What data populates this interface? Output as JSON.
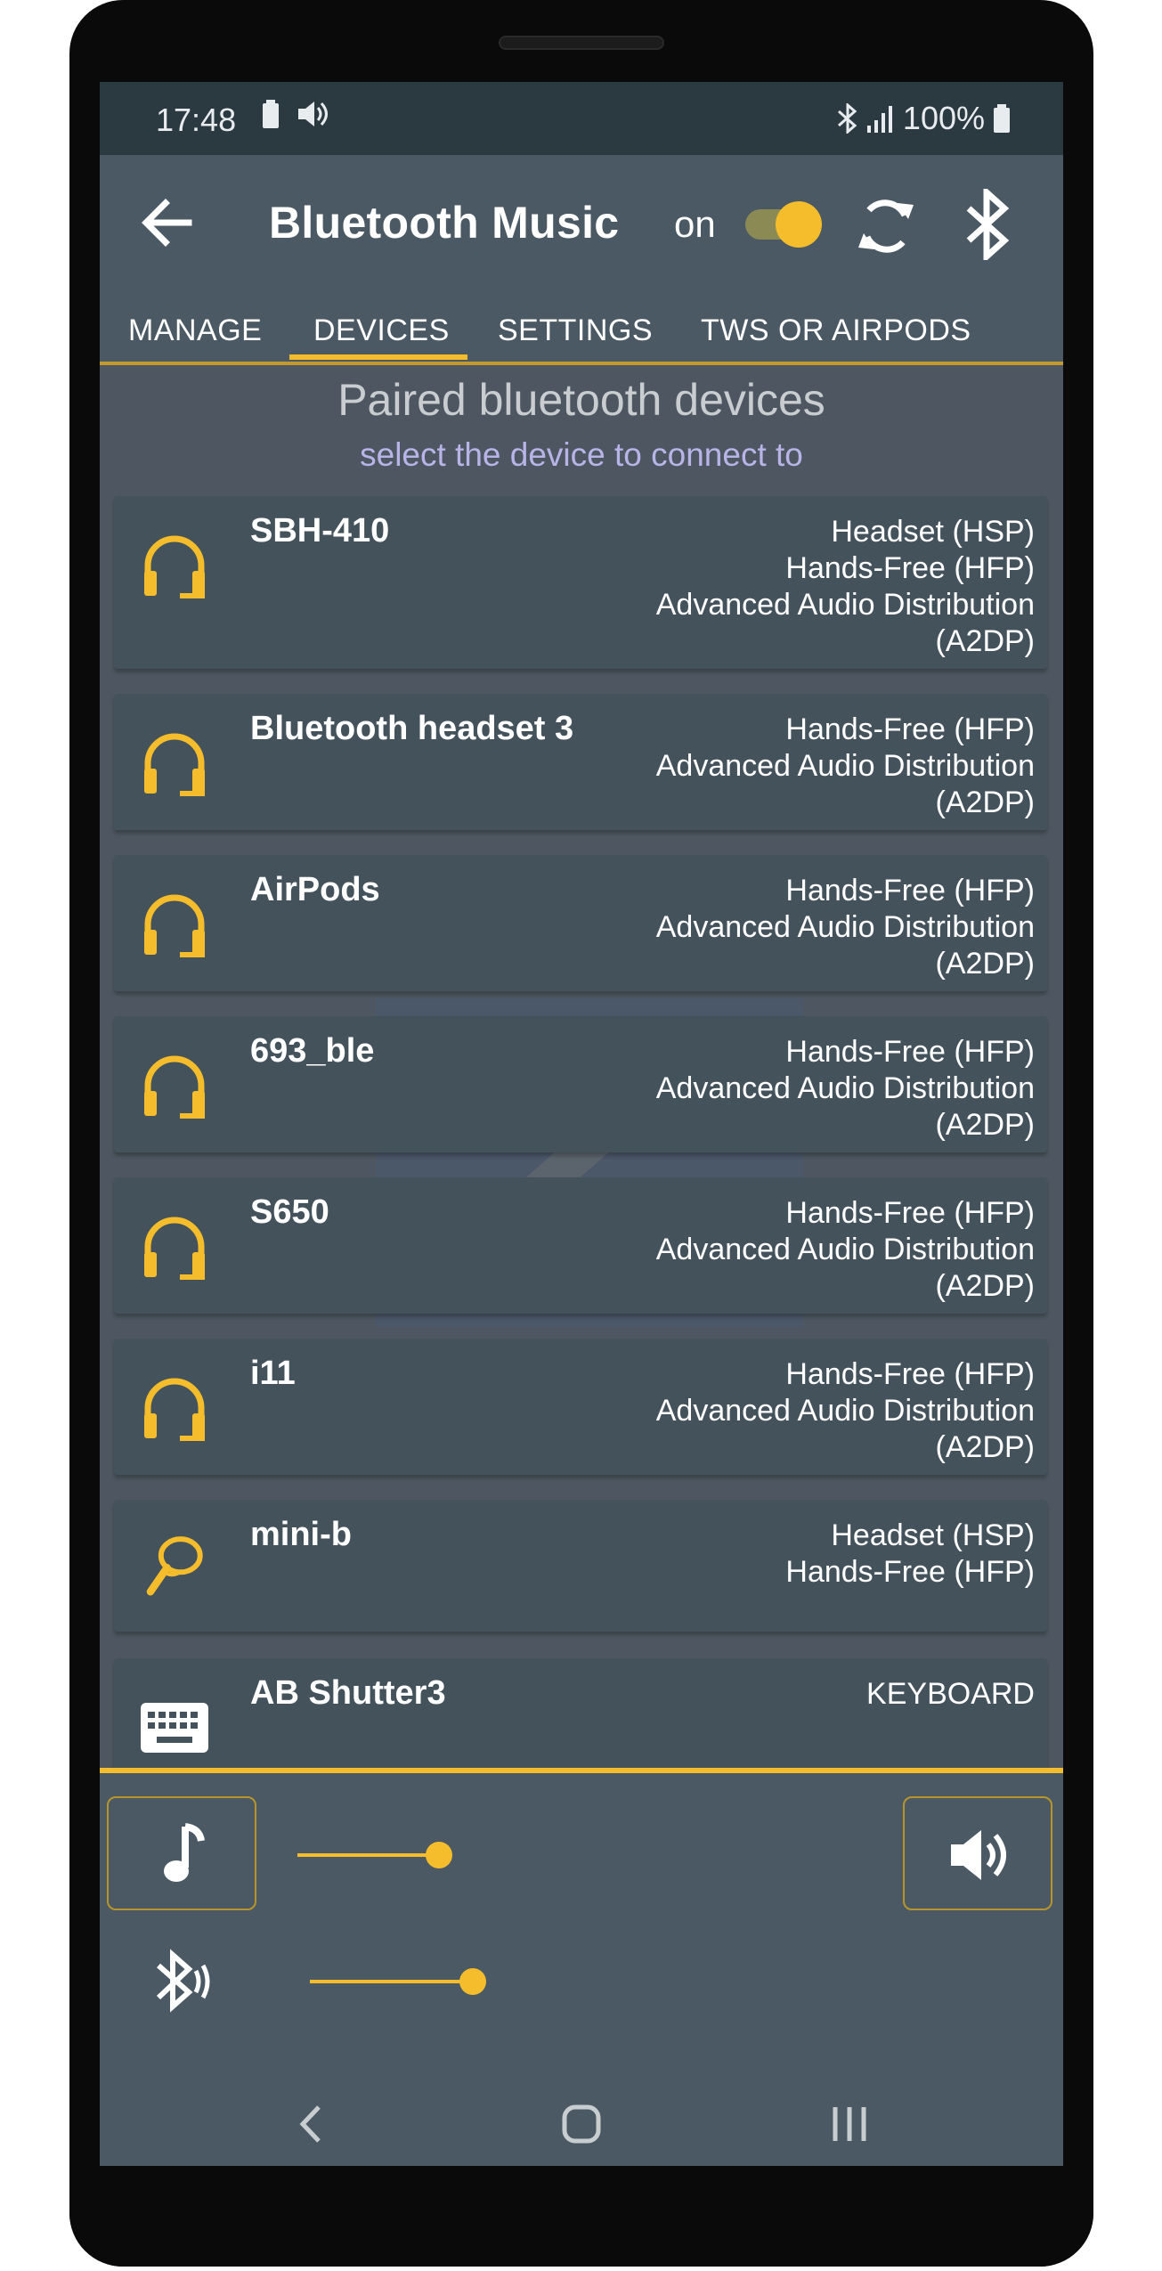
{
  "status_bar": {
    "time": "17:48",
    "battery": "100%"
  },
  "app_bar": {
    "title": "Bluetooth Music",
    "toggle_label": "on"
  },
  "tabs": [
    {
      "label": "MANAGE"
    },
    {
      "label": "DEVICES"
    },
    {
      "label": "SETTINGS"
    },
    {
      "label": "TWS OR AIRPODS"
    }
  ],
  "active_tab": "DEVICES",
  "list_header": {
    "title": "Paired bluetooth devices",
    "subtitle": "select the device to connect to"
  },
  "devices": [
    {
      "name": "SBH-410",
      "icon": "headphones-icon",
      "profiles": [
        "Headset (HSP)",
        "Hands-Free (HFP)",
        "Advanced Audio Distribution",
        "(A2DP)"
      ]
    },
    {
      "name": "Bluetooth headset 3",
      "icon": "headphones-icon",
      "profiles": [
        "Hands-Free (HFP)",
        "Advanced Audio Distribution",
        "(A2DP)"
      ]
    },
    {
      "name": "AirPods",
      "icon": "headphones-icon",
      "profiles": [
        "Hands-Free (HFP)",
        "Advanced Audio Distribution",
        "(A2DP)"
      ]
    },
    {
      "name": "693_ble",
      "icon": "headphones-icon",
      "profiles": [
        "Hands-Free (HFP)",
        "Advanced Audio Distribution",
        "(A2DP)"
      ]
    },
    {
      "name": "S650",
      "icon": "headphones-icon",
      "profiles": [
        "Hands-Free (HFP)",
        "Advanced Audio Distribution",
        "(A2DP)"
      ]
    },
    {
      "name": "i11",
      "icon": "headphones-icon",
      "profiles": [
        "Hands-Free (HFP)",
        "Advanced Audio Distribution",
        "(A2DP)"
      ]
    },
    {
      "name": "mini-b",
      "icon": "bluetooth-earpiece-icon",
      "profiles": [
        "Headset (HSP)",
        "Hands-Free (HFP)"
      ]
    },
    {
      "name": "AB Shutter3",
      "icon": "keyboard-icon",
      "profiles": [
        "KEYBOARD"
      ]
    }
  ],
  "controls": {
    "music_volume": 0.53,
    "bluetooth_volume": 0.61
  },
  "colors": {
    "accent": "#f5bd2b",
    "background": "#4e5761",
    "card": "#44525c",
    "app_bar": "#4a5963"
  }
}
